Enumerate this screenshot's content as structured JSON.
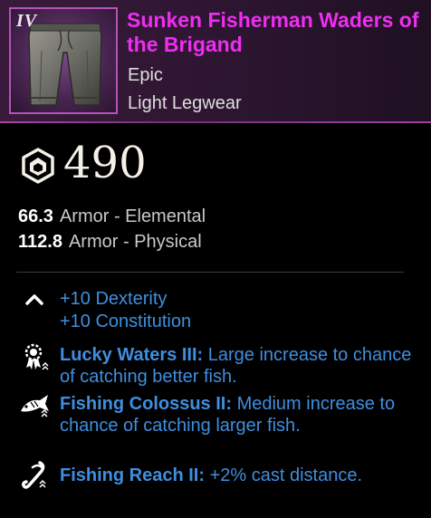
{
  "item": {
    "tier": "IV",
    "name": "Sunken Fisherman Waders of the Brigand",
    "rarity": "Epic",
    "type": "Light Legwear",
    "icon": "waders-icon"
  },
  "gear_score": {
    "value": "490",
    "icon": "gear-score-hexagon-icon"
  },
  "armor": [
    {
      "value": "66.3",
      "label": "Armor - Elemental"
    },
    {
      "value": "112.8",
      "label": "Armor - Physical"
    }
  ],
  "attributes": {
    "icon": "chevron-up-icon",
    "lines": [
      "+10 Dexterity",
      "+10 Constitution"
    ]
  },
  "perks": [
    {
      "icon": "lucky-rosette-icon",
      "name": "Lucky Waters III:",
      "desc": "Large increase to chance of catching better fish."
    },
    {
      "icon": "fish-icon",
      "name": "Fishing Colossus II:",
      "desc": "Medium increase to chance of catching larger fish."
    },
    {
      "icon": "fishing-hook-icon",
      "name": "Fishing Reach II:",
      "desc": "+2% cast distance."
    }
  ],
  "colors": {
    "name": "#ee2ef0",
    "perk": "#3f8fe0",
    "frame": "#b553b8"
  }
}
